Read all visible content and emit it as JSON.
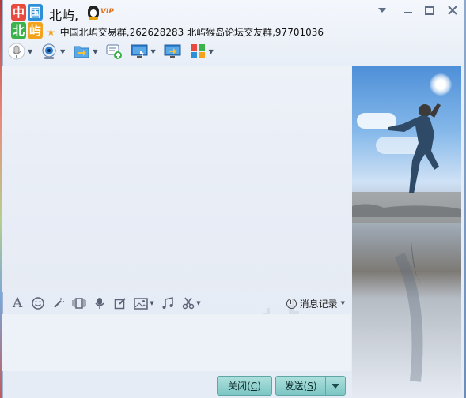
{
  "header": {
    "logo_chars": [
      "中",
      "国",
      "北",
      "屿"
    ],
    "title": "北屿,",
    "vip_label": "VIP",
    "subtitle": "中国北屿交易群,262628283 北屿猴岛论坛交友群,97701036"
  },
  "toolbar": {
    "items": [
      {
        "icon": "microphone-icon"
      },
      {
        "icon": "webcam-icon"
      },
      {
        "icon": "send-file-icon"
      },
      {
        "icon": "add-chat-icon"
      },
      {
        "icon": "remote-assist-icon"
      },
      {
        "icon": "share-screen-icon"
      },
      {
        "icon": "apps-grid-icon"
      }
    ]
  },
  "format_bar": {
    "history_label": "消息记录"
  },
  "buttons": {
    "close_label": "关闭(",
    "close_key": "C",
    "close_end": ")",
    "send_label": "发送(",
    "send_key": "S",
    "send_end": ")"
  },
  "colors": {
    "button": "#8fd0cd",
    "accent_star": "#f2a11f",
    "vip": "#e8711b"
  }
}
